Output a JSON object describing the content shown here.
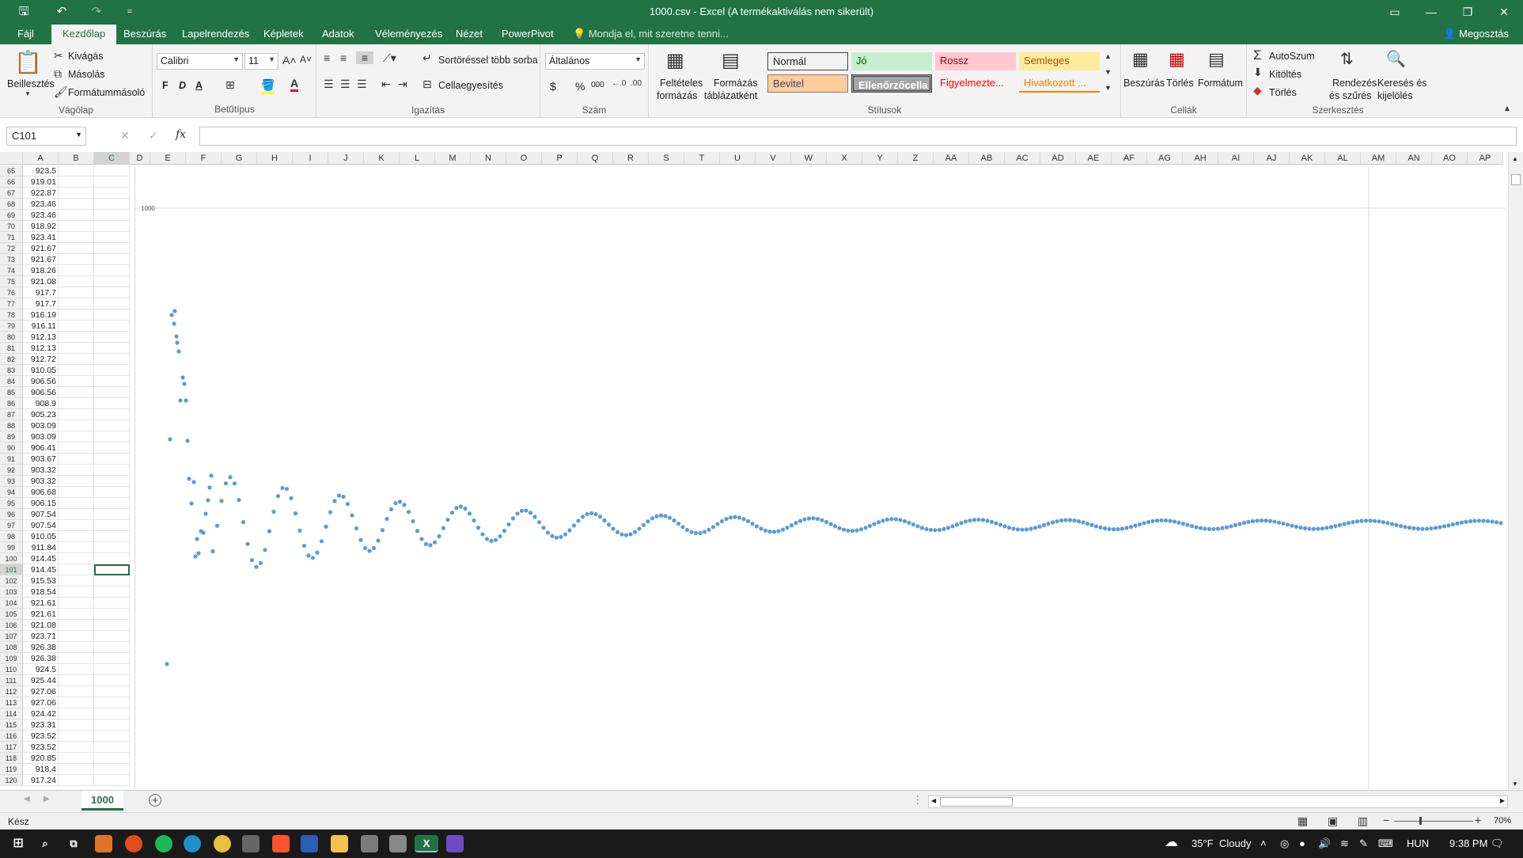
{
  "window": {
    "title": "1000.csv - Excel (A termékaktiválás nem sikerült)",
    "qat_more": "="
  },
  "tabs": [
    {
      "label": "Fájl"
    },
    {
      "label": "Kezdőlap"
    },
    {
      "label": "Beszúrás"
    },
    {
      "label": "Lapelrendezés"
    },
    {
      "label": "Képletek"
    },
    {
      "label": "Adatok"
    },
    {
      "label": "Véleményezés"
    },
    {
      "label": "Nézet"
    },
    {
      "label": "PowerPivot"
    }
  ],
  "tellme": "Mondja el, mit szeretne tenni...",
  "share": "Megosztás",
  "ribbon": {
    "clipboard": {
      "paste": "Beillesztés",
      "cut": "Kivágás",
      "copy": "Másolás",
      "format_painter": "Formátummásoló",
      "label": "Vágólap"
    },
    "font": {
      "name": "Calibri",
      "size": "11",
      "bold": "F",
      "italic": "D",
      "underline": "A",
      "label": "Betűtípus"
    },
    "alignment": {
      "wrap": "Sortöréssel több sorba",
      "merge": "Cellaegyesítés",
      "label": "Igazítás"
    },
    "number": {
      "format": "Általános",
      "currency": "$",
      "percent": "%",
      "thousands": "000",
      "label": "Szám"
    },
    "styles": {
      "conditional": [
        "Feltételes",
        "formázás"
      ],
      "as_table": [
        "Formázás",
        "táblázatként"
      ],
      "cells": [
        {
          "label": "Normál",
          "bg": "#ffffff",
          "fg": "#000000"
        },
        {
          "label": "Jó",
          "bg": "#c6efce",
          "fg": "#006100"
        },
        {
          "label": "Rossz",
          "bg": "#ffc7ce",
          "fg": "#9c0006"
        },
        {
          "label": "Semleges",
          "bg": "#ffeb9c",
          "fg": "#9c5700"
        },
        {
          "label": "Bevitel",
          "bg": "#ffcc99",
          "fg": "#3f3f76"
        },
        {
          "label": "Ellenőrzőcella",
          "bg": "#a5a5a5",
          "fg": "#ffffff"
        },
        {
          "label": "Figyelmezte...",
          "bg": "#ffffff",
          "fg": "#ff0000"
        },
        {
          "label": "Hivatkozott ...",
          "bg": "#ffffff",
          "fg": "#fa7d00"
        }
      ],
      "label": "Stílusok"
    },
    "cells": {
      "insert": "Beszúrás",
      "delete": "Törlés",
      "format": "Formátum",
      "label": "Cellák"
    },
    "editing": {
      "autosum": "AutoSzum",
      "fill": "Kitöltés",
      "clear": "Törlés",
      "sort": [
        "Rendezés",
        "és szűrés"
      ],
      "find": [
        "Keresés és",
        "kijelölés"
      ],
      "label": "Szerkesztés"
    }
  },
  "formula_bar": {
    "name_box": "C101",
    "cancel": "✕",
    "enter": "✓",
    "fx": "fx",
    "value": ""
  },
  "columns": [
    "A",
    "B",
    "C",
    "D",
    "E",
    "F",
    "G",
    "H",
    "I",
    "J",
    "K",
    "L",
    "M",
    "N",
    "O",
    "P",
    "Q",
    "R",
    "S",
    "T",
    "U",
    "V",
    "W",
    "X",
    "Y",
    "Z",
    "AA",
    "AB",
    "AC",
    "AD",
    "AE",
    "AF",
    "AG",
    "AH",
    "AI",
    "AJ",
    "AK",
    "AL",
    "AM",
    "AN",
    "AO",
    "AP"
  ],
  "rows": [
    {
      "n": "65",
      "a": "923.5"
    },
    {
      "n": "66",
      "a": "919.01"
    },
    {
      "n": "67",
      "a": "922.87"
    },
    {
      "n": "68",
      "a": "923.46"
    },
    {
      "n": "69",
      "a": "923.46"
    },
    {
      "n": "70",
      "a": "918.92"
    },
    {
      "n": "71",
      "a": "923.41"
    },
    {
      "n": "72",
      "a": "921.67"
    },
    {
      "n": "73",
      "a": "921.67"
    },
    {
      "n": "74",
      "a": "918.26"
    },
    {
      "n": "75",
      "a": "921.08"
    },
    {
      "n": "76",
      "a": "917.7"
    },
    {
      "n": "77",
      "a": "917.7"
    },
    {
      "n": "78",
      "a": "916.19"
    },
    {
      "n": "79",
      "a": "916.11"
    },
    {
      "n": "80",
      "a": "912.13"
    },
    {
      "n": "81",
      "a": "912.13"
    },
    {
      "n": "82",
      "a": "912.72"
    },
    {
      "n": "83",
      "a": "910.05"
    },
    {
      "n": "84",
      "a": "906.56"
    },
    {
      "n": "85",
      "a": "906.56"
    },
    {
      "n": "86",
      "a": "908.9"
    },
    {
      "n": "87",
      "a": "905.23"
    },
    {
      "n": "88",
      "a": "903.09"
    },
    {
      "n": "89",
      "a": "903.09"
    },
    {
      "n": "90",
      "a": "906.41"
    },
    {
      "n": "91",
      "a": "903.67"
    },
    {
      "n": "92",
      "a": "903.32"
    },
    {
      "n": "93",
      "a": "903.32"
    },
    {
      "n": "94",
      "a": "906.68"
    },
    {
      "n": "95",
      "a": "906.15"
    },
    {
      "n": "96",
      "a": "907.54"
    },
    {
      "n": "97",
      "a": "907.54"
    },
    {
      "n": "98",
      "a": "910.05"
    },
    {
      "n": "99",
      "a": "911.84"
    },
    {
      "n": "100",
      "a": "914.45"
    },
    {
      "n": "101",
      "a": "914.45"
    },
    {
      "n": "102",
      "a": "915.53"
    },
    {
      "n": "103",
      "a": "918.54"
    },
    {
      "n": "104",
      "a": "921.61"
    },
    {
      "n": "105",
      "a": "921.61"
    },
    {
      "n": "106",
      "a": "921.08"
    },
    {
      "n": "107",
      "a": "923.71"
    },
    {
      "n": "108",
      "a": "926.38"
    },
    {
      "n": "109",
      "a": "926.38"
    },
    {
      "n": "110",
      "a": "924.5"
    },
    {
      "n": "111",
      "a": "925.44"
    },
    {
      "n": "112",
      "a": "927.06"
    },
    {
      "n": "113",
      "a": "927.06"
    },
    {
      "n": "114",
      "a": "924.42"
    },
    {
      "n": "115",
      "a": "923.31"
    },
    {
      "n": "116",
      "a": "923.52"
    },
    {
      "n": "117",
      "a": "923.52"
    },
    {
      "n": "118",
      "a": "920.85"
    },
    {
      "n": "119",
      "a": "918.4"
    },
    {
      "n": "120",
      "a": "917.24"
    }
  ],
  "selected_row": "101",
  "chart": {
    "y_tick_label": "1000",
    "series_color": "#5b9bd5"
  },
  "sheet_tab": "1000",
  "status": {
    "mode": "Kész",
    "zoom": "70%"
  },
  "taskbar": {
    "weather_temp": "35°F",
    "weather_text": "Cloudy",
    "lang": "HUN",
    "time": "9:38 PM"
  }
}
